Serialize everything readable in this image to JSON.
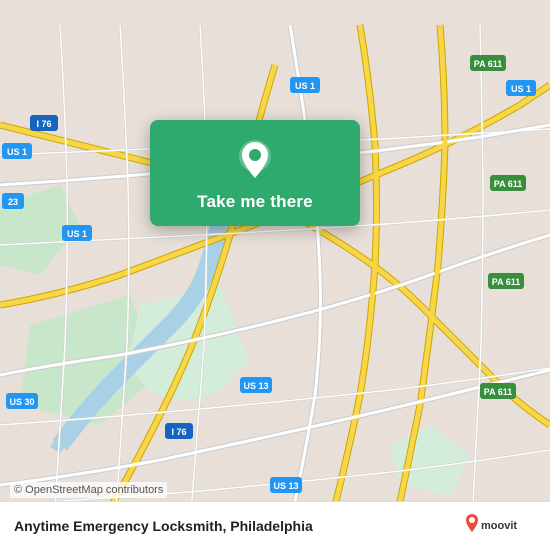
{
  "map": {
    "background_color": "#e8e0d8",
    "copyright": "© OpenStreetMap contributors"
  },
  "popup": {
    "label": "Take me there",
    "pin_icon": "location-pin"
  },
  "bottom_bar": {
    "business_name": "Anytime Emergency Locksmith",
    "city": "Philadelphia",
    "full_text": "Anytime Emergency Locksmith, Philadelphia"
  },
  "moovit": {
    "brand": "moovit"
  },
  "highway_labels": [
    {
      "id": "i76_nw",
      "text": "I 76",
      "type": "i"
    },
    {
      "id": "us1_n",
      "text": "US 1",
      "type": "us"
    },
    {
      "id": "us1_w",
      "text": "US 1",
      "type": "us"
    },
    {
      "id": "us1_c",
      "text": "US 1",
      "type": "us"
    },
    {
      "id": "pa611_ne1",
      "text": "PA 611",
      "type": "pa"
    },
    {
      "id": "pa611_ne2",
      "text": "PA 611",
      "type": "pa"
    },
    {
      "id": "pa611_e",
      "text": "PA 611",
      "type": "pa"
    },
    {
      "id": "pa611_se",
      "text": "PA 611",
      "type": "pa"
    },
    {
      "id": "us13_c",
      "text": "US 13",
      "type": "us"
    },
    {
      "id": "us13_s",
      "text": "US 13",
      "type": "us"
    },
    {
      "id": "i76_s",
      "text": "I 76",
      "type": "i"
    },
    {
      "id": "us30_w",
      "text": "US 30",
      "type": "us"
    },
    {
      "id": "n23_w",
      "text": "23",
      "type": "us"
    }
  ]
}
